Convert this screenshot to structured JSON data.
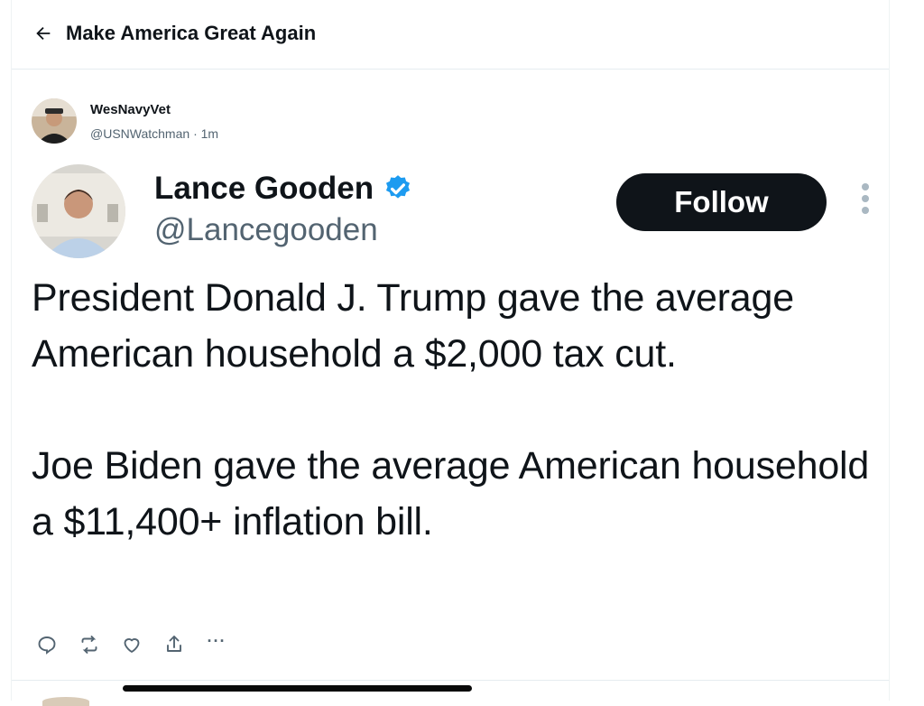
{
  "header": {
    "back_icon": "arrow-left-icon",
    "title": "Make America Great Again"
  },
  "post": {
    "author_name": "WesNavyVet",
    "author_handle": "@USNWatchman",
    "separator": "·",
    "time": "1m"
  },
  "embedded": {
    "name": "Lance Gooden",
    "handle": "@Lancegooden",
    "verified_icon": "verified-badge-icon",
    "follow_label": "Follow",
    "paragraph_1": "President Donald J. Trump gave the average American household a $2,000 tax cut.",
    "paragraph_2": "Joe Biden gave the average American household a $11,400+ inflation bill."
  },
  "actions": {
    "reply_icon": "reply-icon",
    "repost_icon": "repost-icon",
    "like_icon": "heart-icon",
    "share_icon": "share-icon",
    "more_label": "···"
  },
  "colors": {
    "text": "#0f1419",
    "secondary": "#536471",
    "verified": "#1d9bf0",
    "follow_bg": "#0f1419"
  }
}
